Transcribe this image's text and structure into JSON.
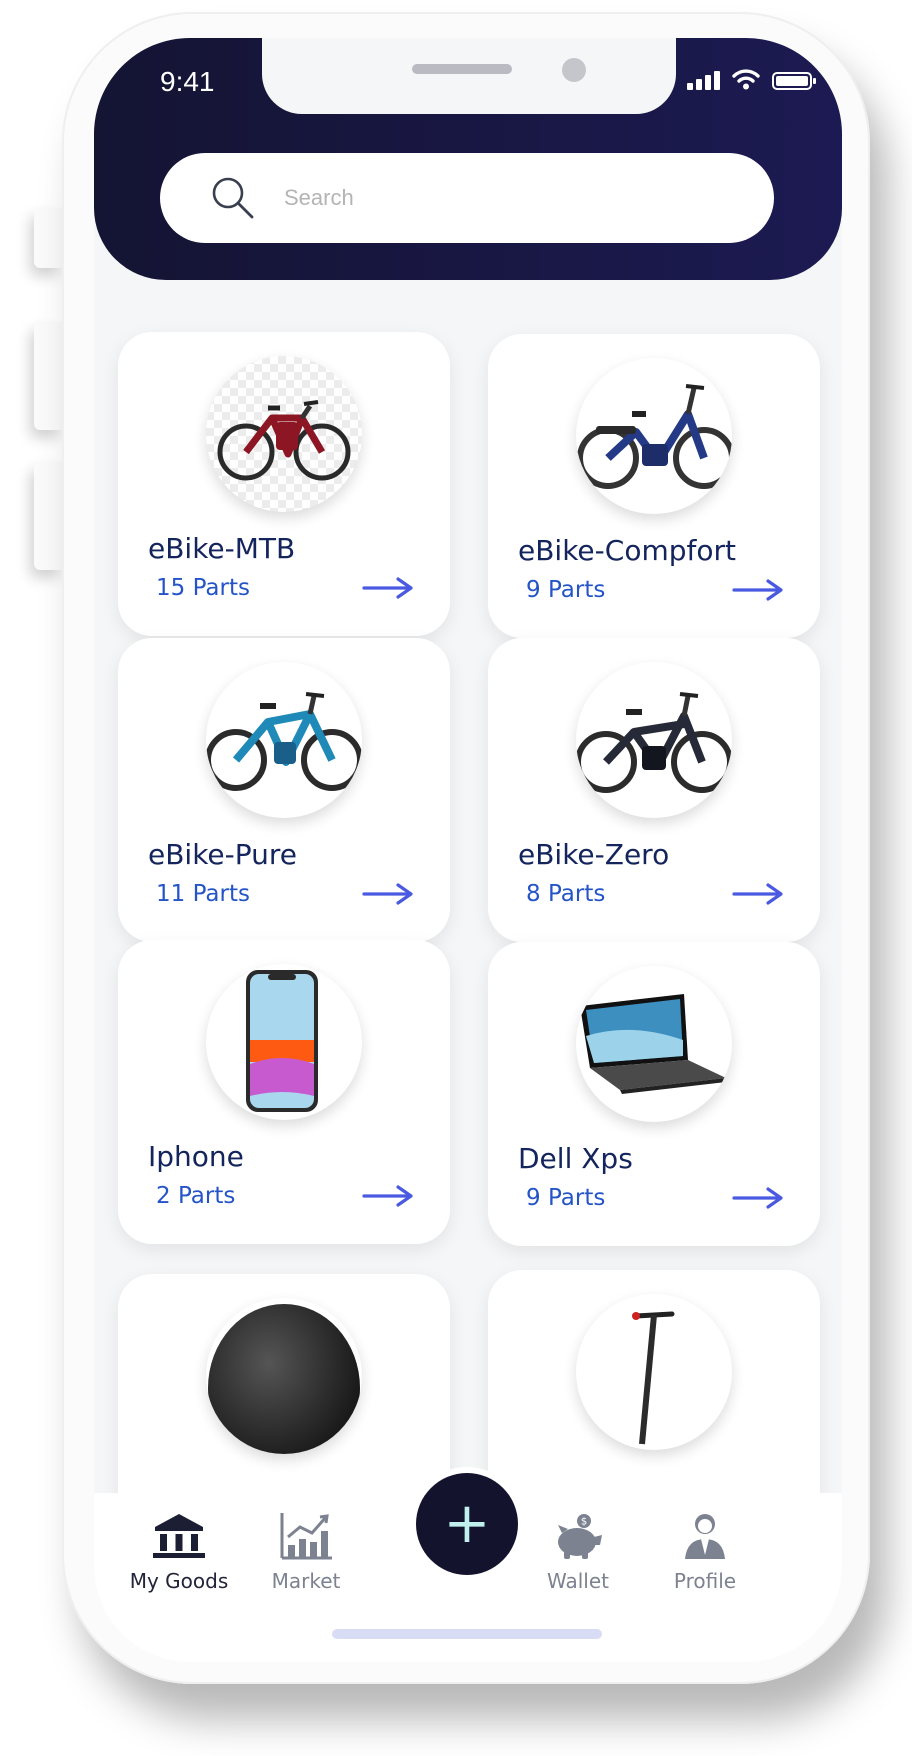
{
  "status_bar": {
    "time": "9:41"
  },
  "search": {
    "placeholder": "Search"
  },
  "items": [
    {
      "name": "eBike-MTB",
      "parts": "15 Parts"
    },
    {
      "name": "eBike-Compfort",
      "parts": "9 Parts"
    },
    {
      "name": "eBike-Pure",
      "parts": "11 Parts"
    },
    {
      "name": "eBike-Zero",
      "parts": "8 Parts"
    },
    {
      "name": "Iphone",
      "parts": "2 Parts"
    },
    {
      "name": "Dell Xps",
      "parts": "9 Parts"
    }
  ],
  "nav": {
    "my_goods": "My Goods",
    "market": "Market",
    "add": "+",
    "wallet": "Wallet",
    "profile": "Profile"
  },
  "colors": {
    "header": "#141433",
    "accent_arrow": "#4a5ae0",
    "title": "#14245c",
    "parts": "#2454c8"
  }
}
